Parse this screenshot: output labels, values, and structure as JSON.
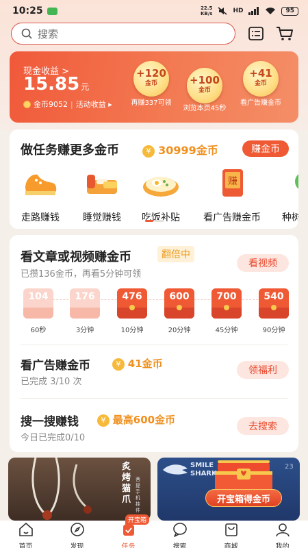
{
  "status_bar": {
    "time": "10:25",
    "net_speed_top": "22.5",
    "net_speed_bottom": "KB/s",
    "network": "HD",
    "battery": "95"
  },
  "search": {
    "placeholder": "搜索"
  },
  "earnings": {
    "cash_label": "现金收益 >",
    "cash_amount": "15.85",
    "cash_unit": "元",
    "coins": "金币9052",
    "activity": "活动收益 ▸",
    "bubbles": [
      {
        "amount": "+120",
        "unit": "金币",
        "caption": "再赚337可领"
      },
      {
        "amount": "+100",
        "unit": "金币",
        "caption": "浏览本页45秒"
      },
      {
        "amount": "+41",
        "unit": "金币",
        "caption": "看广告赚金币"
      }
    ]
  },
  "tasks": {
    "title": "做任务赚更多金币",
    "coin_total": "30999金币",
    "button": "赚金币",
    "items": [
      {
        "label": "走路赚钱",
        "icon": "sneaker-icon"
      },
      {
        "label": "睡觉赚钱",
        "icon": "bed-icon"
      },
      {
        "label": "吃饭补贴",
        "icon": "meal-icon"
      },
      {
        "label": "看广告赚金币",
        "icon": "ad-book-icon"
      },
      {
        "label": "种树",
        "icon": "tree-icon"
      }
    ]
  },
  "video_task": {
    "title": "看文章或视频赚金币",
    "tag": "翻倍中",
    "subtitle": "已攒136金币，再看5分钟可领",
    "button": "看视频",
    "packets": [
      {
        "value": "104",
        "label": "60秒",
        "claimed": true
      },
      {
        "value": "176",
        "label": "3分钟",
        "claimed": true
      },
      {
        "value": "476",
        "label": "10分钟",
        "claimed": false
      },
      {
        "value": "600",
        "label": "20分钟",
        "claimed": false
      },
      {
        "value": "700",
        "label": "45分钟",
        "claimed": false
      },
      {
        "value": "540",
        "label": "90分钟",
        "claimed": false
      }
    ]
  },
  "ad_task": {
    "title": "看广告赚金币",
    "reward": "41金币",
    "progress": "已完成 3/10 次",
    "button": "领福利"
  },
  "search_task": {
    "title": "搜一搜赚钱",
    "reward": "最高600金币",
    "progress": "今日已完成0/10",
    "button": "去搜索"
  },
  "banners": {
    "left_text_1": "炙",
    "left_text_2": "烤",
    "left_text_3": "猫",
    "left_text_4": "爪",
    "left_small": "菩提手机挂件",
    "right_brand": "SMILE SHARK",
    "right_num": "23",
    "treasure_button": "开宝箱得金币"
  },
  "nav": {
    "items": [
      {
        "label": "首页",
        "icon": "home-icon"
      },
      {
        "label": "发现",
        "icon": "compass-icon"
      },
      {
        "label": "任务",
        "icon": "task-icon",
        "badge": "开宝箱",
        "active": true
      },
      {
        "label": "搜索",
        "icon": "search-icon"
      },
      {
        "label": "商城",
        "icon": "shop-bag-icon"
      },
      {
        "label": "我的",
        "icon": "user-icon"
      }
    ]
  },
  "colors": {
    "accent": "#ef5a35",
    "coin": "#f0901e",
    "background": "#f5efe9"
  }
}
